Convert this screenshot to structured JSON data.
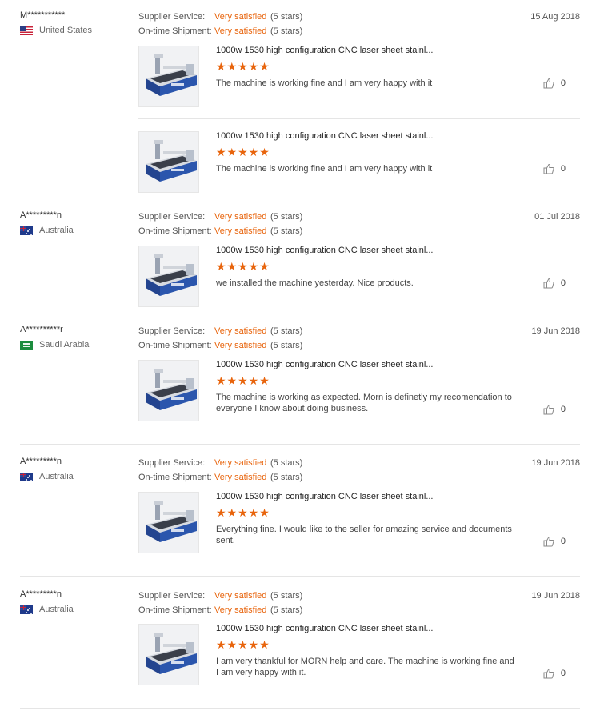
{
  "labels": {
    "supplier_service": "Supplier Service:",
    "ontime_shipment": "On-time Shipment:"
  },
  "reviews": [
    {
      "name": "M***********l",
      "country": "United States",
      "flag": "us",
      "date": "15 Aug 2018",
      "supplier_value": "Very satisfied",
      "supplier_stars": "(5 stars)",
      "shipment_value": "Very satisfied",
      "shipment_stars": "(5 stars)",
      "items": [
        {
          "title": "1000w 1530 high configuration CNC laser sheet stainl...",
          "stars": "★★★★★",
          "text": "The machine is working fine and I am very happy with it",
          "likes": "0",
          "rating": 5
        },
        {
          "title": "1000w 1530 high configuration CNC laser sheet stainl...",
          "stars": "★★★★★",
          "text": "The machine is working fine and I am very happy with it",
          "likes": "0",
          "rating": 5
        }
      ]
    },
    {
      "name": "A*********n",
      "country": "Australia",
      "flag": "au",
      "date": "01 Jul 2018",
      "supplier_value": "Very satisfied",
      "supplier_stars": "(5 stars)",
      "shipment_value": "Very satisfied",
      "shipment_stars": "(5 stars)",
      "items": [
        {
          "title": "1000w 1530 high configuration CNC laser sheet stainl...",
          "stars": "★★★★★",
          "text": "we installed the machine yesterday. Nice products.",
          "likes": "0",
          "rating": 5
        }
      ]
    },
    {
      "name": "A**********r",
      "country": "Saudi Arabia",
      "flag": "sa",
      "date": "19 Jun 2018",
      "supplier_value": "Very satisfied",
      "supplier_stars": "(5 stars)",
      "shipment_value": "Very satisfied",
      "shipment_stars": "(5 stars)",
      "items": [
        {
          "title": "1000w 1530 high configuration CNC laser sheet stainl...",
          "stars": "★★★★★",
          "text": "The machine is working as expected. Morn is definetly my recomendation to everyone I know about doing business.",
          "likes": "0",
          "rating": 5
        }
      ]
    },
    {
      "name": "A*********n",
      "country": "Australia",
      "flag": "au",
      "date": "19 Jun 2018",
      "supplier_value": "Very satisfied",
      "supplier_stars": "(5 stars)",
      "shipment_value": "Very satisfied",
      "shipment_stars": "(5 stars)",
      "items": [
        {
          "title": "1000w 1530 high configuration CNC laser sheet stainl...",
          "stars": "★★★★★",
          "text": "Everything fine. I would like to the seller for amazing service and documents sent.",
          "likes": "0",
          "rating": 5
        }
      ]
    },
    {
      "name": "A*********n",
      "country": "Australia",
      "flag": "au",
      "date": "19 Jun 2018",
      "supplier_value": "Very satisfied",
      "supplier_stars": "(5 stars)",
      "shipment_value": "Very satisfied",
      "shipment_stars": "(5 stars)",
      "items": [
        {
          "title": "1000w 1530 high configuration CNC laser sheet stainl...",
          "stars": "★★★★★",
          "text": "I am very thankful for MORN help and care. The machine is working fine and I am very happy with it.",
          "likes": "0",
          "rating": 5
        }
      ]
    }
  ]
}
